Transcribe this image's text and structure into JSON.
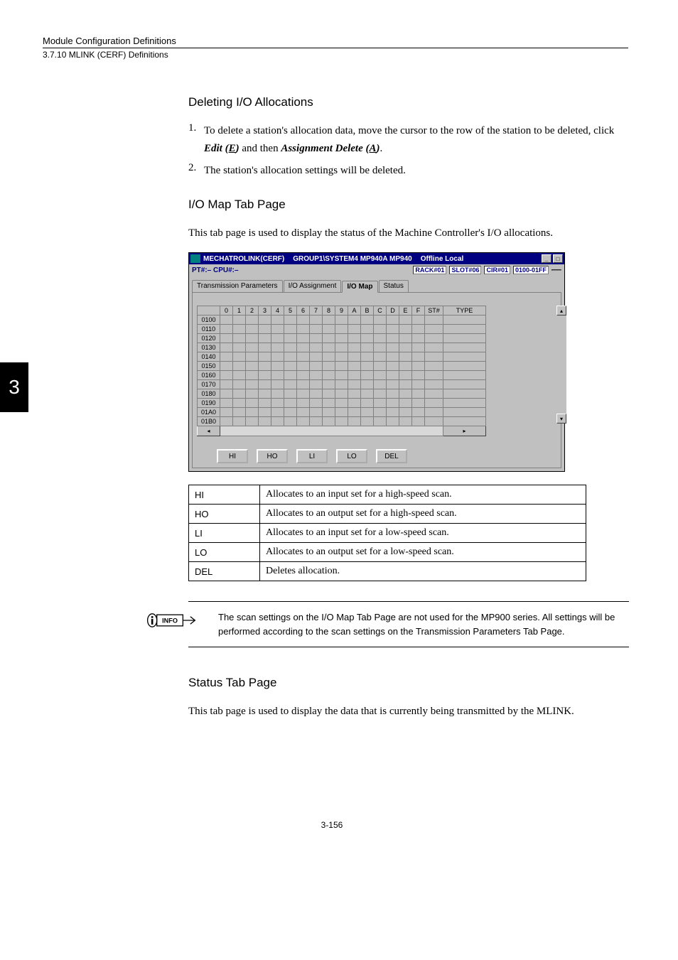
{
  "header": {
    "top": "Module Configuration Definitions",
    "sub": "3.7.10  MLINK (CERF) Definitions"
  },
  "chapter_tab": "3",
  "sec1": {
    "title": "Deleting I/O Allocations",
    "item1_pre": "To delete a station's allocation data, move the cursor to the row of the station to be deleted, click ",
    "item1_em1": "Edit (",
    "item1_key1": "E",
    "item1_em1b": ")",
    "item1_mid": " and then ",
    "item1_em2": "Assignment Delete (",
    "item1_key2": "A",
    "item1_em2b": ")",
    "item1_post": ".",
    "item2": "The station's allocation settings will be deleted."
  },
  "sec2": {
    "title": "I/O Map Tab Page",
    "intro": "This tab page is used to display the status of the Machine Controller's I/O allocations."
  },
  "window": {
    "title_left": "MECHATROLINK(CERF)",
    "title_mid": "GROUP1\\SYSTEM4  MP940A  MP940",
    "title_right": "Offline  Local",
    "info_left": "PT#:– CPU#:–",
    "rack": "RACK#01",
    "slot": "SLOT#06",
    "cir": "CIR#01",
    "range": "0100-01FF",
    "tabs": {
      "t1": "Transmission Parameters",
      "t2": "I/O Assignment",
      "t3": "I/O Map",
      "t4": "Status"
    },
    "cols": [
      "0",
      "1",
      "2",
      "3",
      "4",
      "5",
      "6",
      "7",
      "8",
      "9",
      "A",
      "B",
      "C",
      "D",
      "E",
      "F",
      "ST#",
      "TYPE"
    ],
    "rows": [
      "0100",
      "0110",
      "0120",
      "0130",
      "0140",
      "0150",
      "0160",
      "0170",
      "0180",
      "0190",
      "01A0",
      "01B0"
    ],
    "buttons": {
      "hi": "HI",
      "ho": "HO",
      "li": "LI",
      "lo": "LO",
      "del": "DEL"
    }
  },
  "deftable": {
    "r1k": "HI",
    "r1v": "Allocates to an input set for a high-speed scan.",
    "r2k": "HO",
    "r2v": "Allocates to an output set for a high-speed scan.",
    "r3k": "LI",
    "r3v": "Allocates to an input set for a low-speed scan.",
    "r4k": "LO",
    "r4v": "Allocates to an output set for a low-speed scan.",
    "r5k": "DEL",
    "r5v": "Deletes allocation."
  },
  "info": {
    "label": "INFO",
    "text": "The scan settings on the I/O Map Tab Page are not used for the MP900 series. All settings will be performed according to the scan settings on the Transmission Parameters Tab Page."
  },
  "sec3": {
    "title": "Status Tab Page",
    "intro": "This tab page is used to display the data that is currently being transmitted by the MLINK."
  },
  "footer": "3-156"
}
